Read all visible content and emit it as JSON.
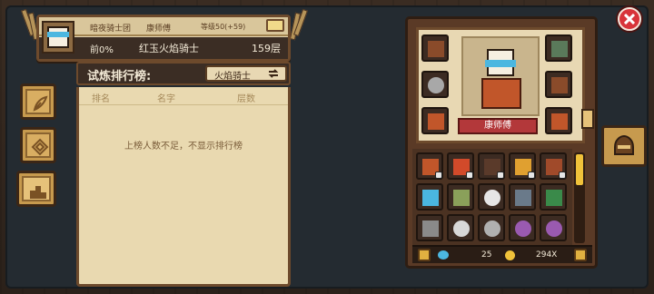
{
  "header": {
    "guild": "暗夜骑士团",
    "player_name": "康师傅",
    "level": "等级50(+59)",
    "rank_percent": "前0%",
    "floor_title": "红玉火焰骑士",
    "floor": "159层"
  },
  "ranking": {
    "title": "试炼排行榜:",
    "selected": "火焰骑士",
    "columns": [
      "排名",
      "名字",
      "层数"
    ],
    "empty_message": "上榜人数不足，不显示排行榜"
  },
  "hero": {
    "name": "康师傅"
  },
  "currency": {
    "gems": "25",
    "coins": "294X"
  },
  "colors": {
    "panel_tan": "#e8d8b3",
    "panel_brown": "#3b2d24",
    "accent_red": "#d8343a",
    "accent_gold": "#f0c23a"
  },
  "icons": {
    "close": "close-icon",
    "refresh": "refresh-icon",
    "feather": "feather-icon",
    "diamond": "diamond-icon",
    "podium": "podium-icon",
    "helmet": "helmet-icon"
  }
}
